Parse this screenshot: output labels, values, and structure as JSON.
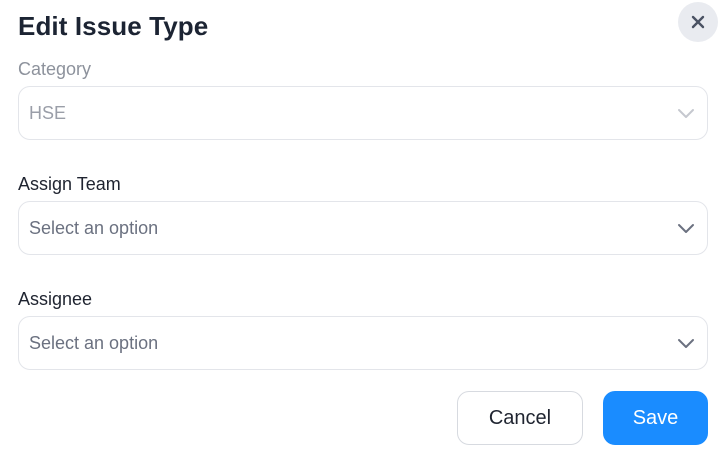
{
  "dialog": {
    "title": "Edit Issue Type",
    "close_icon": "close-icon"
  },
  "fields": {
    "category": {
      "label": "Category",
      "value": "HSE",
      "disabled": true
    },
    "assign_team": {
      "label": "Assign Team",
      "placeholder": "Select an option"
    },
    "assignee": {
      "label": "Assignee",
      "placeholder": "Select an option"
    }
  },
  "actions": {
    "cancel_label": "Cancel",
    "save_label": "Save"
  },
  "colors": {
    "primary": "#1a8cff",
    "border": "#e3e5ea",
    "close_bg": "#e9ebf0"
  },
  "icons": {
    "dropdown": "chevron-down-icon"
  }
}
